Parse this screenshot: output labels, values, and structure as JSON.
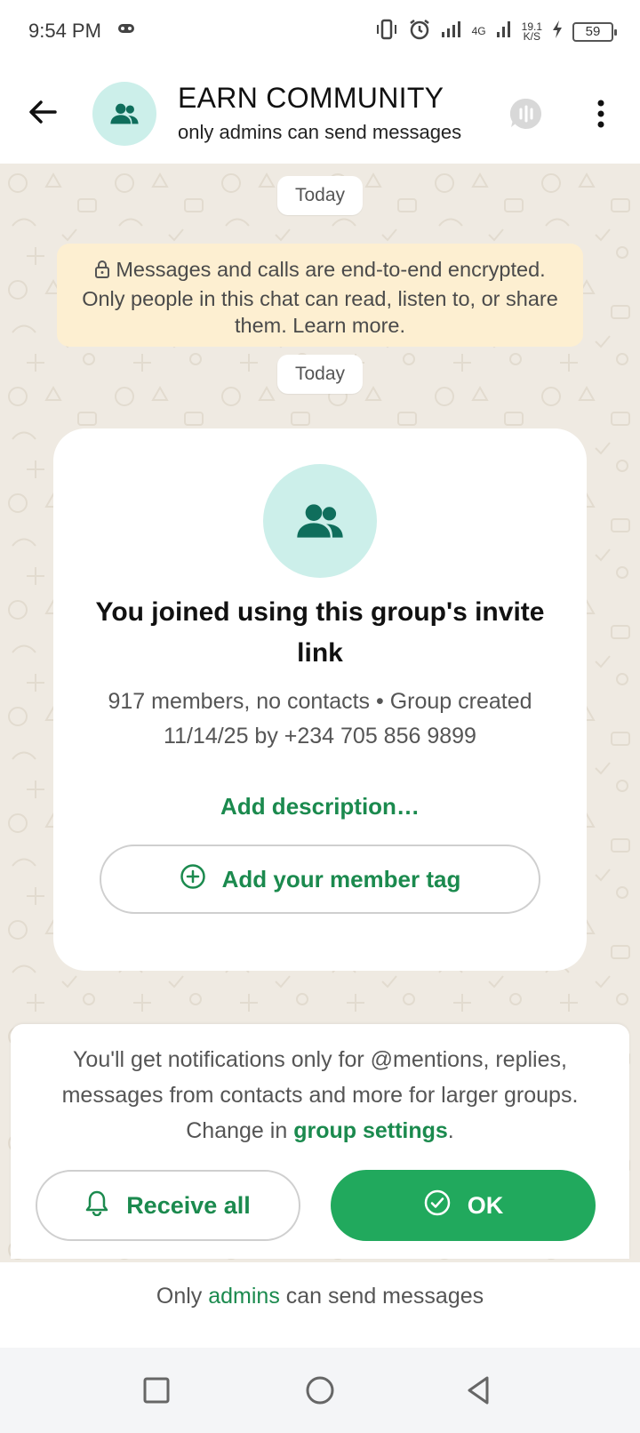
{
  "status_bar": {
    "time": "9:54 PM",
    "network_label": "4G",
    "speed_value": "19.1",
    "speed_unit": "K/S",
    "battery": "59"
  },
  "header": {
    "title": "EARN COMMUNITY",
    "subtitle": "only admins can send messages"
  },
  "chat": {
    "date_chip_1": "Today",
    "encryption_notice": "Messages and calls are end-to-end encrypted. Only people in this chat can read, listen to, or share them. Learn more.",
    "date_chip_2": "Today",
    "card": {
      "title": "You joined using this group's invite link",
      "meta": "917 members, no contacts • Group created 11/14/25 by +234 705 856 9899",
      "add_description": "Add description…",
      "member_tag_button": "Add your member tag"
    }
  },
  "notification_panel": {
    "text_before": "You'll get notifications only for @mentions, replies, messages from contacts and more for larger groups. Change in ",
    "link": "group settings",
    "text_after": ".",
    "receive_all_button": "Receive all",
    "ok_button": "OK"
  },
  "footer": {
    "before": "Only ",
    "admins": "admins",
    "after": " can send messages"
  },
  "colors": {
    "accent_green": "#21a95d",
    "link_green": "#1b8a4e",
    "chat_bg": "#efeae2",
    "encryption_bg": "#fdefd1",
    "avatar_bg": "#ccefea"
  },
  "icons": [
    "game-controller-icon",
    "vibrate-icon",
    "alarm-icon",
    "signal-icon",
    "battery-icon",
    "back-arrow-icon",
    "group-icon",
    "voice-chat-icon",
    "more-vert-icon",
    "lock-icon",
    "add-circle-icon",
    "bell-icon",
    "check-circle-icon",
    "nav-recents-icon",
    "nav-home-icon",
    "nav-back-icon"
  ]
}
